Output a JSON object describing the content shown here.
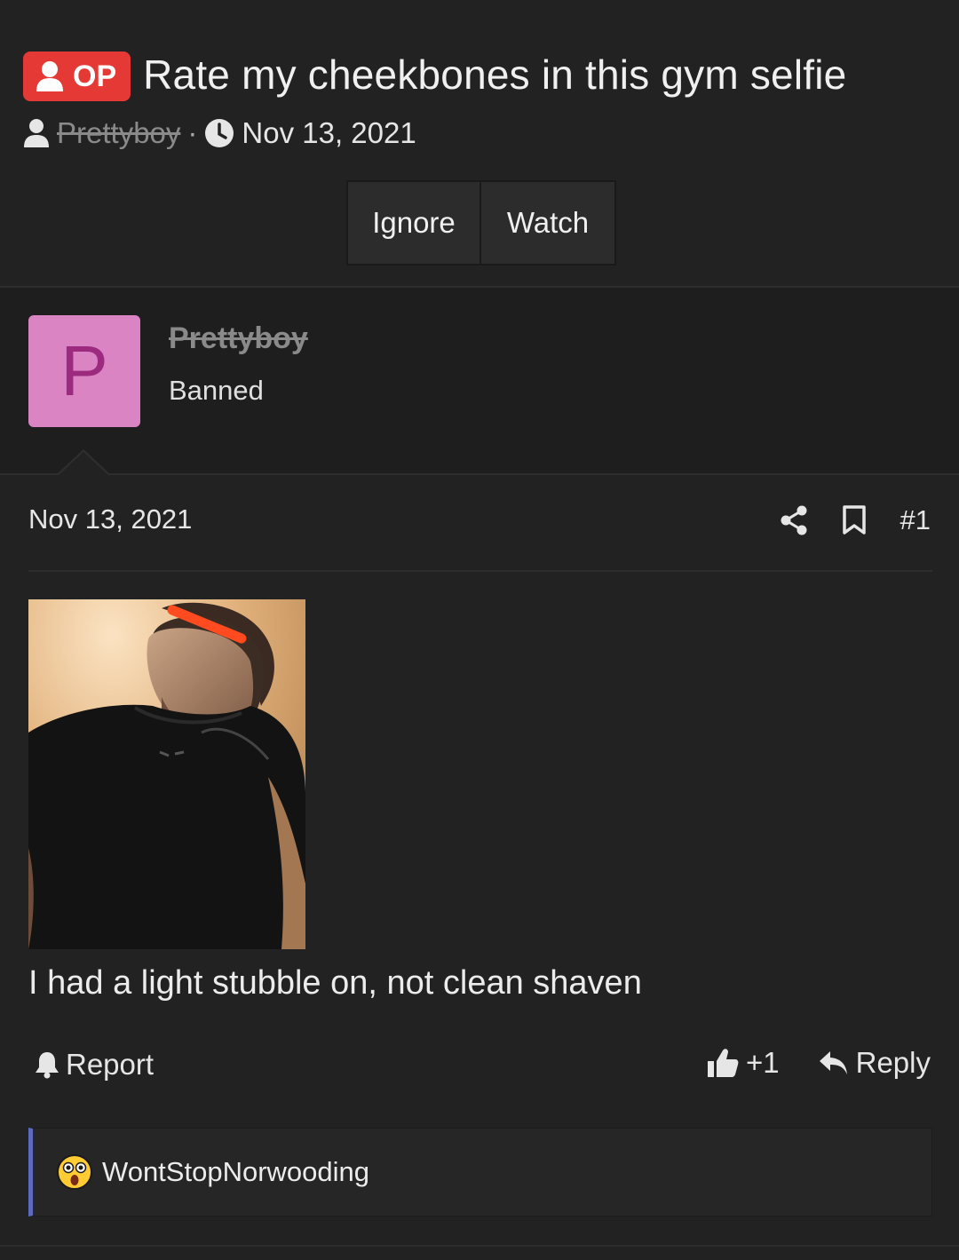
{
  "thread": {
    "op_badge": "OP",
    "title": "Rate my cheekbones in this gym selfie",
    "author": "Prettyboy",
    "separator": "·",
    "date": "Nov 13, 2021"
  },
  "thread_buttons": {
    "ignore": "Ignore",
    "watch": "Watch"
  },
  "user": {
    "avatar_letter": "P",
    "avatar_color": "#db84c4",
    "name": "Prettyboy",
    "title": "Banned"
  },
  "post": {
    "date": "Nov 13, 2021",
    "number": "#1",
    "text": "I had a light stubble on, not clean shaven",
    "report_label": "Report",
    "like_count": "+1",
    "reply_label": "Reply",
    "icons": [
      "share-icon",
      "bookmark-icon",
      "bell-icon",
      "thumbs-up-icon",
      "reply-icon"
    ]
  },
  "reactions": {
    "user": "WontStopNorwooding",
    "emoji": "astonished-face"
  },
  "colors": {
    "background": "#222222",
    "op_badge": "#e53935",
    "accent": "#5c6bc0"
  }
}
